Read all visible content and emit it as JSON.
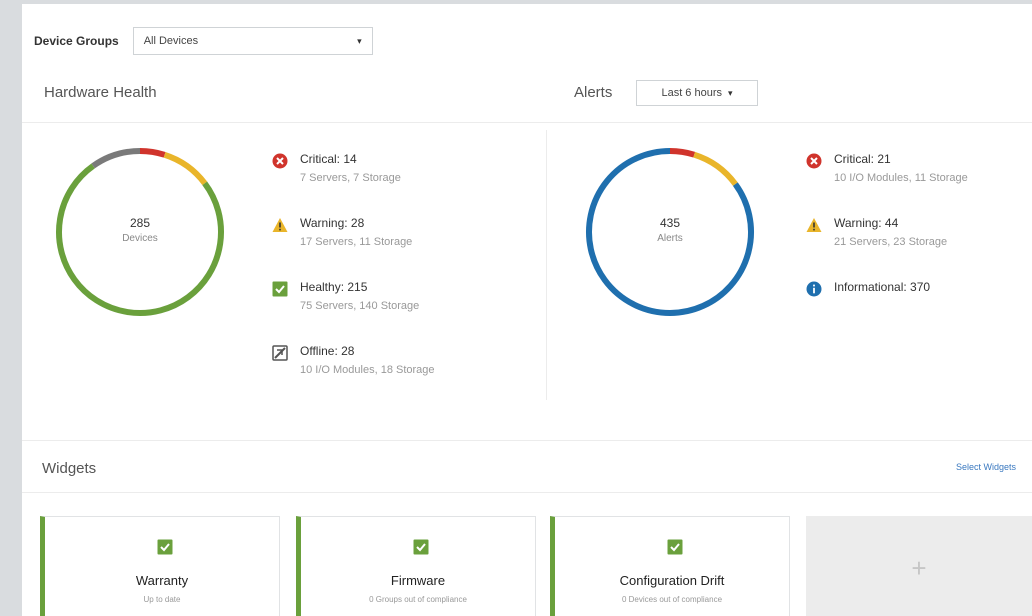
{
  "filter": {
    "label": "Device Groups",
    "selected": "All Devices",
    "caret": "▾"
  },
  "hardware_health": {
    "title": "Hardware Health",
    "total": "285",
    "unit": "Devices",
    "segments": [
      {
        "key": "critical",
        "value": 14,
        "color": "#d0342c"
      },
      {
        "key": "warning",
        "value": 28,
        "color": "#e9b52a"
      },
      {
        "key": "healthy",
        "value": 215,
        "color": "#6aa03c"
      },
      {
        "key": "offline",
        "value": 28,
        "color": "#7a7a7a"
      }
    ],
    "legend": [
      {
        "icon": "critical-icon",
        "title": "Critical: 14",
        "detail": "7 Servers, 7 Storage"
      },
      {
        "icon": "warning-icon",
        "title": "Warning: 28",
        "detail": "17 Servers, 11 Storage"
      },
      {
        "icon": "healthy-icon",
        "title": "Healthy: 215",
        "detail": "75 Servers, 140 Storage"
      },
      {
        "icon": "offline-icon",
        "title": "Offline: 28",
        "detail": "10 I/O Modules, 18 Storage"
      }
    ]
  },
  "alerts": {
    "title": "Alerts",
    "range": "Last 6 hours",
    "caret": "▾",
    "total": "435",
    "unit": "Alerts",
    "segments": [
      {
        "key": "critical",
        "value": 21,
        "color": "#d0342c"
      },
      {
        "key": "warning",
        "value": 44,
        "color": "#e9b52a"
      },
      {
        "key": "informational",
        "value": 370,
        "color": "#1f6fae"
      }
    ],
    "legend": [
      {
        "icon": "critical-icon",
        "title": "Critical: 21",
        "detail": "10 I/O Modules, 11 Storage"
      },
      {
        "icon": "warning-icon",
        "title": "Warning: 44",
        "detail": "21 Servers, 23 Storage"
      },
      {
        "icon": "info-icon",
        "title": "Informational: 370",
        "detail": ""
      }
    ]
  },
  "widgets": {
    "title": "Widgets",
    "select_link": "Select Widgets",
    "cards": [
      {
        "title": "Warranty",
        "subtitle": "Up to date"
      },
      {
        "title": "Firmware",
        "subtitle": "0 Groups out of compliance"
      },
      {
        "title": "Configuration Drift",
        "subtitle": "0 Devices out of compliance"
      }
    ],
    "add_symbol": "+"
  },
  "colors": {
    "critical": "#d0342c",
    "warning": "#e9b52a",
    "healthy": "#6aa03c",
    "offline": "#7a7a7a",
    "info": "#1f6fae"
  }
}
